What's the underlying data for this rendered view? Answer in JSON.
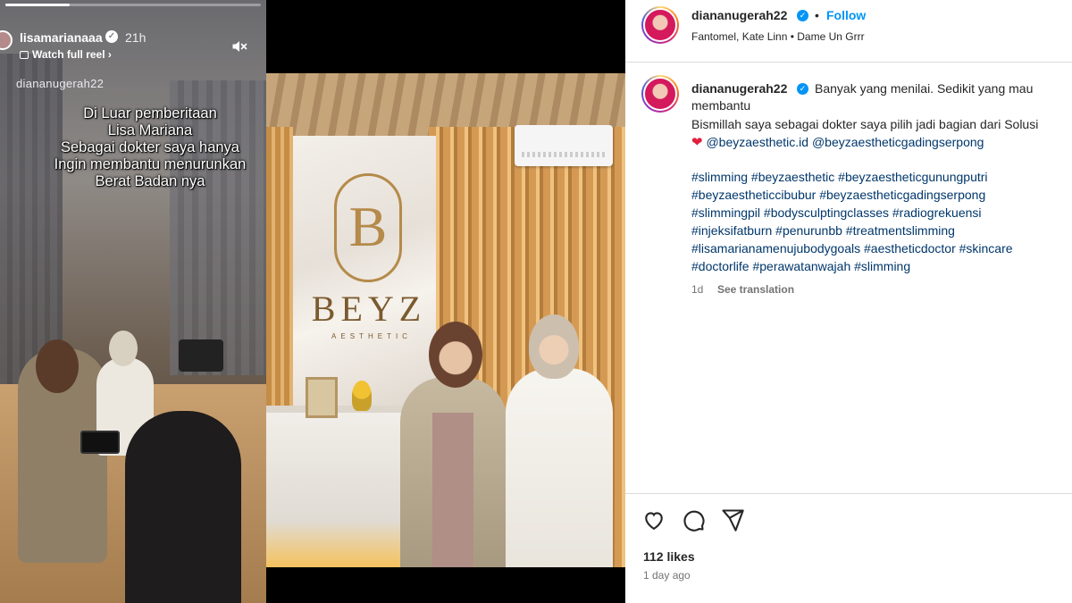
{
  "story": {
    "username": "lisamarianaaa",
    "time_ago": "21h",
    "watch_reel_label": "Watch full reel",
    "tagged_user": "diananugerah22",
    "progress_fraction": 0.25,
    "caption_lines": [
      "Di Luar pemberitaan",
      "Lisa Mariana",
      "Sebagai dokter saya hanya",
      "Ingin membantu menurunkan",
      "Berat Badan nya"
    ],
    "mute_icon": "speaker-muted-icon"
  },
  "photo": {
    "brand_name": "BEYZ",
    "brand_sub": "AESTHETIC"
  },
  "post": {
    "header": {
      "username": "diananugerah22",
      "separator": "•",
      "follow_label": "Follow",
      "audio": "Fantomel, Kate Linn • Dame Un Grrr"
    },
    "caption": {
      "username": "diananugerah22",
      "line1": "Banyak yang menilai. Sedikit yang mau",
      "line2": "membantu",
      "line3": "Bismillah saya sebagai dokter saya pilih jadi bagian dari Solusi",
      "heart": "❤",
      "mentions": [
        "@beyzaesthetic.id",
        "@beyzaestheticgadingserpong"
      ],
      "hashtag_lines": [
        "#slimming #beyzaesthetic #beyzaestheticgunungputri",
        "#beyzaestheticcibubur #beyzaestheticgadingserpong",
        "#slimmingpil #bodysculptingclasses #radiogrekuensi",
        "#injeksifatburn #penurunbb #treatmentslimming",
        "#lisamarianamenujubodygoals #aestheticdoctor #skincare",
        "#doctorlife #perawatanwajah #slimming"
      ],
      "time_ago": "1d",
      "see_translation": "See translation"
    },
    "actions": [
      "heart-icon",
      "comment-icon",
      "share-icon"
    ],
    "likes": "112 likes",
    "posted": "1 day ago"
  },
  "colors": {
    "link": "#00376b",
    "follow": "#0095f6",
    "verified": "#0095f6",
    "heart": "#e0203e"
  }
}
